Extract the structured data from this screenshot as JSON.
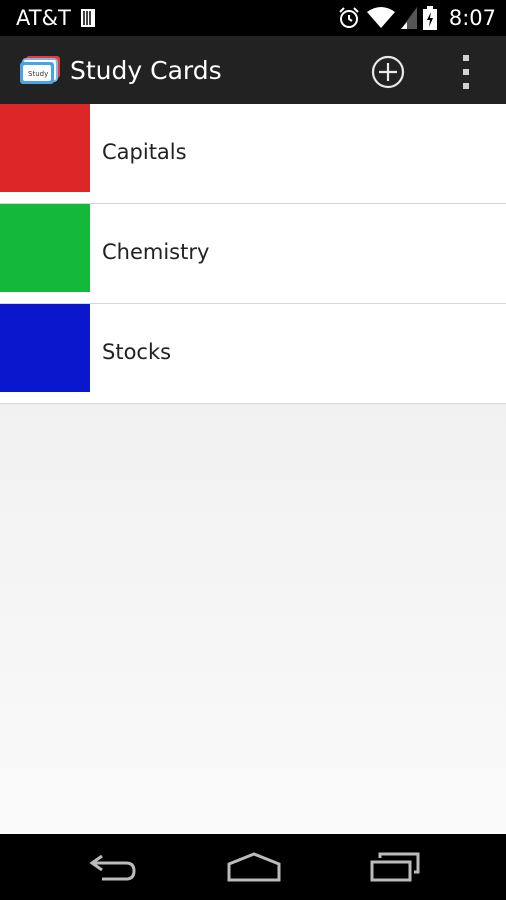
{
  "status_bar": {
    "carrier": "AT&T",
    "time": "8:07",
    "icons": [
      "sim-icon",
      "alarm-icon",
      "wifi-icon",
      "signal-icon",
      "battery-icon"
    ]
  },
  "action_bar": {
    "title": "Study Cards",
    "icons": [
      "app-logo-icon",
      "add-icon",
      "overflow-menu-icon"
    ]
  },
  "decks": [
    {
      "label": "Capitals",
      "color": "#dd2628"
    },
    {
      "label": "Chemistry",
      "color": "#14b93c"
    },
    {
      "label": "Stocks",
      "color": "#0b17cc"
    }
  ],
  "nav_bar": {
    "icons": [
      "back-icon",
      "home-icon",
      "recents-icon"
    ]
  }
}
